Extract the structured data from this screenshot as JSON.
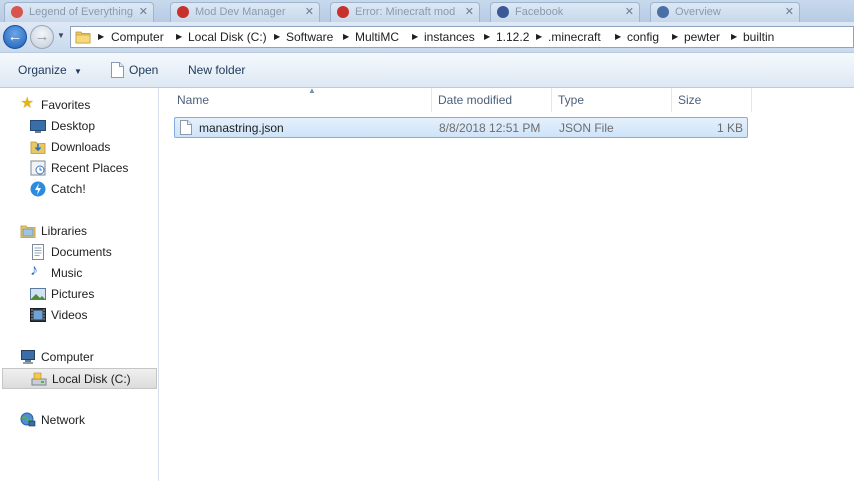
{
  "browser_tabs": [
    {
      "title": "Legend of Everything",
      "color": "#d9534f"
    },
    {
      "title": "Mod Dev Manager",
      "color": "#c9302c"
    },
    {
      "title": "Error: Minecraft mod",
      "color": "#c9302c"
    },
    {
      "title": "Facebook",
      "color": "#3b5998"
    },
    {
      "title": "Overview",
      "color": "#4a6fa5"
    }
  ],
  "address": {
    "crumbs": [
      "Computer",
      "Local Disk (C:)",
      "Software",
      "MultiMC",
      "instances",
      "1.12.2",
      ".minecraft",
      "config",
      "pewter",
      "builtin"
    ]
  },
  "toolbar": {
    "organize_label": "Organize",
    "open_label": "Open",
    "new_folder_label": "New folder"
  },
  "nav": {
    "favorites_label": "Favorites",
    "favorites": [
      "Desktop",
      "Downloads",
      "Recent Places",
      "Catch!"
    ],
    "libraries_label": "Libraries",
    "libraries": [
      "Documents",
      "Music",
      "Pictures",
      "Videos"
    ],
    "computer_label": "Computer",
    "computer": [
      "Local Disk (C:)"
    ],
    "network_label": "Network"
  },
  "columns": {
    "name": "Name",
    "date": "Date modified",
    "type": "Type",
    "size": "Size"
  },
  "files": [
    {
      "name": "manastring.json",
      "date": "8/8/2018 12:51 PM",
      "type": "JSON File",
      "size": "1 KB"
    }
  ],
  "colors": {
    "accent": "#1d5fb8",
    "selection": "#cfe3f8",
    "header_text": "#4c607a"
  }
}
